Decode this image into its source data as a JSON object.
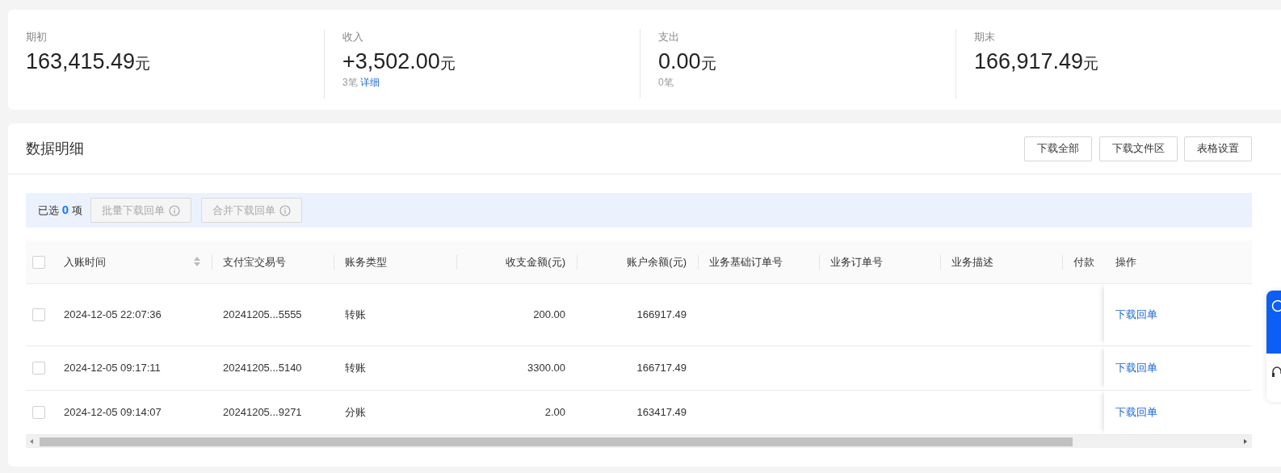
{
  "summary": [
    {
      "label": "期初",
      "amount": "163,415.49",
      "unit": "元"
    },
    {
      "label": "收入",
      "amount": "+3,502.00",
      "unit": "元",
      "count": "3笔",
      "link": "详细"
    },
    {
      "label": "支出",
      "amount": "0.00",
      "unit": "元",
      "count": "0笔"
    },
    {
      "label": "期末",
      "amount": "166,917.49",
      "unit": "元"
    }
  ],
  "detail": {
    "title": "数据明细",
    "buttons": [
      "下载全部",
      "下载文件区",
      "表格设置"
    ]
  },
  "selection": {
    "prefix": "已选",
    "count": "0",
    "suffix": "项",
    "actions": [
      {
        "label": "批量下载回单",
        "disabled": true
      },
      {
        "label": "合并下载回单",
        "disabled": true
      }
    ]
  },
  "table": {
    "all_checked": false,
    "columns": [
      {
        "label": "入账时间",
        "sortable": true,
        "kind": "text"
      },
      {
        "label": "支付宝交易号",
        "sortable": false,
        "kind": "text"
      },
      {
        "label": "账务类型",
        "sortable": false,
        "kind": "text"
      },
      {
        "label": "收支金额(元)",
        "sortable": false,
        "kind": "amount"
      },
      {
        "label": "账户余额(元)",
        "sortable": false,
        "kind": "amount"
      },
      {
        "label": "业务基础订单号",
        "sortable": false,
        "kind": "text"
      },
      {
        "label": "业务订单号",
        "sortable": false,
        "kind": "text"
      },
      {
        "label": "业务描述",
        "sortable": false,
        "kind": "text"
      },
      {
        "label": "付款",
        "kind": "text"
      },
      {
        "label": "操作",
        "sortable": false,
        "kind": "text"
      }
    ],
    "rows": [
      {
        "checked": false,
        "cells": [
          "2024-12-05 22:07:36",
          "20241205...5555",
          "转账",
          "200.00",
          "166917.49",
          "",
          "",
          "",
          ""
        ],
        "action": "下载回单"
      },
      {
        "checked": false,
        "cells": [
          "2024-12-05 09:17:11",
          "20241205...5140",
          "转账",
          "3300.00",
          "166717.49",
          "",
          "",
          "",
          ""
        ],
        "action": "下载回单"
      },
      {
        "checked": false,
        "cells": [
          "2024-12-05 09:14:07",
          "20241205...9271",
          "分账",
          "2.00",
          "163417.49",
          "",
          "",
          "",
          ""
        ],
        "action": "下载回单"
      }
    ]
  }
}
